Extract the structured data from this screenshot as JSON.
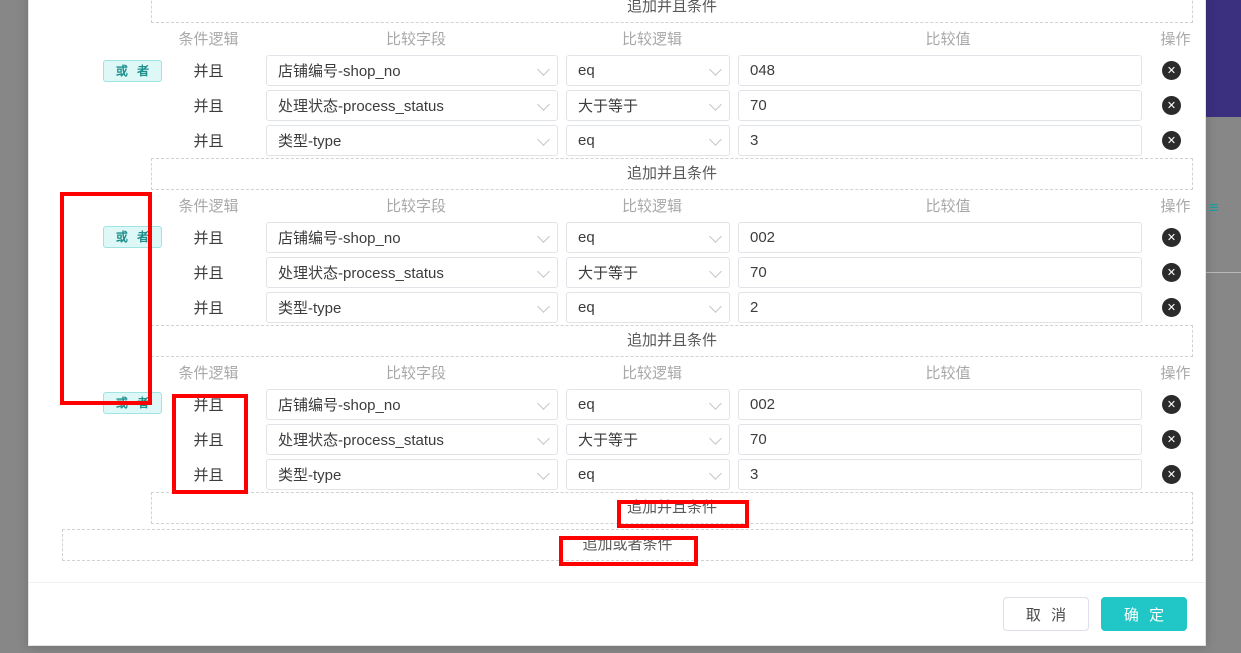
{
  "background": {
    "header_strip_color": "#3b3080",
    "overlay_color": "#878787",
    "glyph": "≡"
  },
  "modal": {
    "columns": {
      "logic": "条件逻辑",
      "field": "比较字段",
      "operator": "比较逻辑",
      "value": "比较值",
      "action": "操作"
    },
    "labels": {
      "add_and_condition": "追加并且条件",
      "add_or_condition": "追加或者条件",
      "or_badge": "或 者",
      "and_logic": "并且",
      "delete_icon": "✕"
    },
    "groups": [
      {
        "badge": "或 者",
        "show_badge": true,
        "rows": [
          {
            "logic": "并且",
            "field": "店铺编号-shop_no",
            "operator": "eq",
            "value": "048"
          },
          {
            "logic": "并且",
            "field": "处理状态-process_status",
            "operator": "大于等于",
            "value": "70"
          },
          {
            "logic": "并且",
            "field": "类型-type",
            "operator": "eq",
            "value": "3"
          }
        ]
      },
      {
        "badge": "或 者",
        "show_badge": true,
        "rows": [
          {
            "logic": "并且",
            "field": "店铺编号-shop_no",
            "operator": "eq",
            "value": "002"
          },
          {
            "logic": "并且",
            "field": "处理状态-process_status",
            "operator": "大于等于",
            "value": "70"
          },
          {
            "logic": "并且",
            "field": "类型-type",
            "operator": "eq",
            "value": "2"
          }
        ]
      },
      {
        "badge": "或 者",
        "show_badge": true,
        "rows": [
          {
            "logic": "并且",
            "field": "店铺编号-shop_no",
            "operator": "eq",
            "value": "002"
          },
          {
            "logic": "并且",
            "field": "处理状态-process_status",
            "operator": "大于等于",
            "value": "70"
          },
          {
            "logic": "并且",
            "field": "类型-type",
            "operator": "eq",
            "value": "3"
          }
        ]
      }
    ],
    "footer": {
      "cancel": "取 消",
      "confirm": "确 定",
      "confirm_color": "#21c6c6"
    }
  },
  "annotations": {
    "color": "#fe0000",
    "boxes": [
      {
        "name": "or-group-highlight"
      },
      {
        "name": "and-logic-column-highlight"
      },
      {
        "name": "add-and-condition-highlight"
      },
      {
        "name": "add-or-condition-highlight"
      }
    ]
  }
}
